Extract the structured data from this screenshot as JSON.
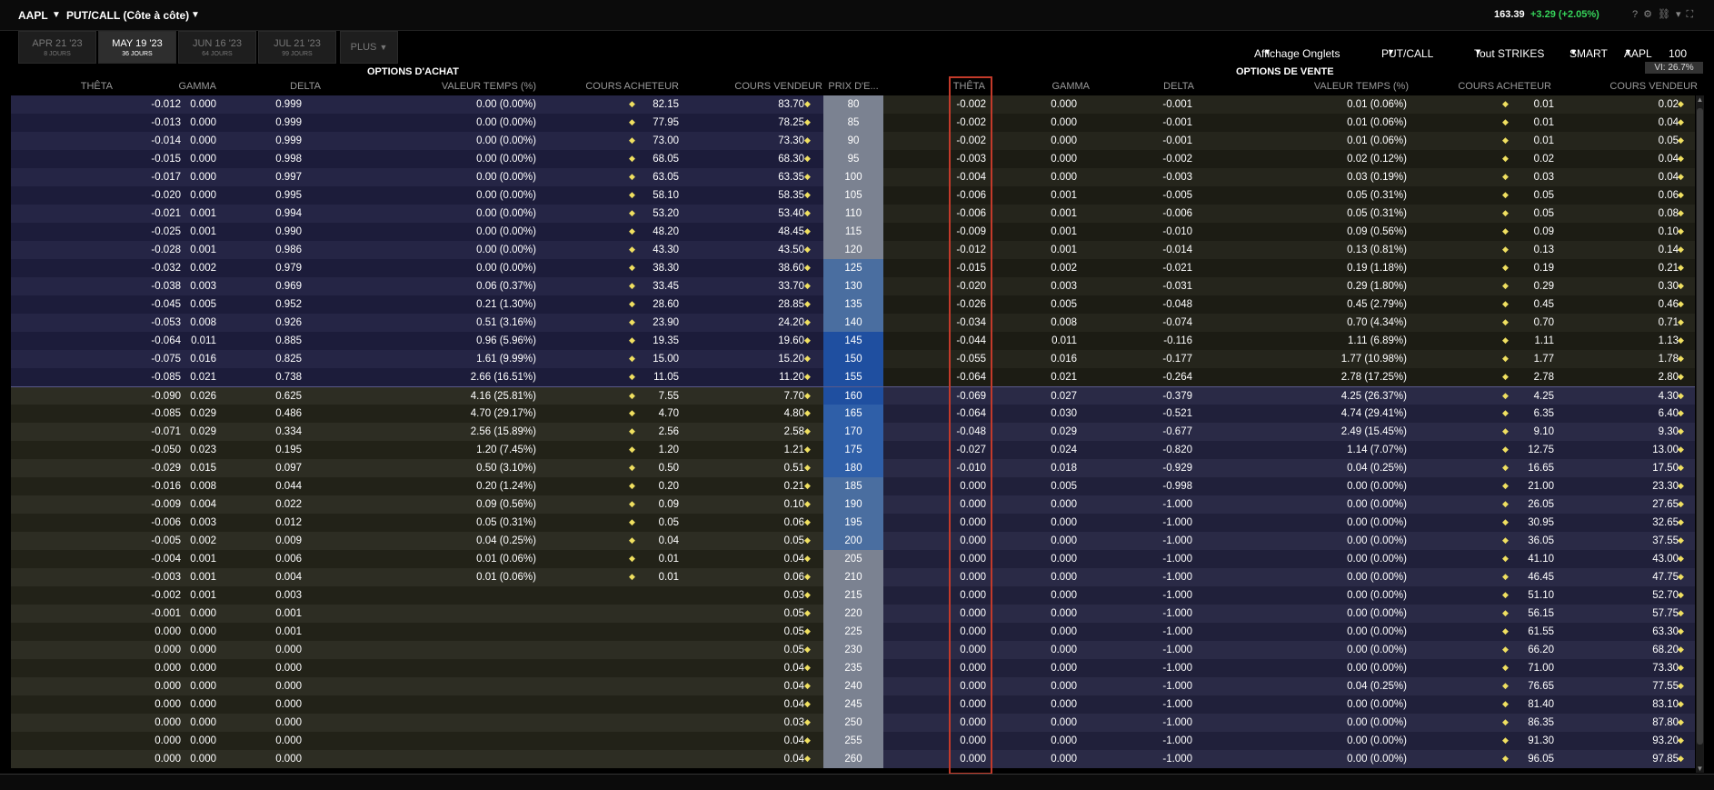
{
  "title": {
    "symbol": "AAPL",
    "mode": "PUT/CALL (Côte à côte)",
    "last": "163.39",
    "change": "+3.29 (+2.05%)"
  },
  "tabs": [
    {
      "date": "APR 21 '23",
      "days": "8 JOURS"
    },
    {
      "date": "MAY 19 '23",
      "days": "36 JOURS"
    },
    {
      "date": "JUN 16 '23",
      "days": "64 JOURS"
    },
    {
      "date": "JUL 21 '23",
      "days": "99 JOURS"
    },
    {
      "date": "PLUS",
      "days": ""
    }
  ],
  "toolbar": {
    "display": "Affichage Onglets",
    "putcall": "PUT/CALL",
    "strikes": "Tout STRIKES",
    "exchange": "SMART",
    "symbol": "AAPL",
    "qty": "100",
    "vi": "VI: 26.7%"
  },
  "sections": {
    "calls": "OPTIONS D'ACHAT",
    "puts": "OPTIONS DE VENTE"
  },
  "headers": {
    "theta": "THÊTA",
    "gamma": "GAMMA",
    "delta": "DELTA",
    "time_value": "VALEUR TEMPS (%)",
    "bid": "COURS ACHETEUR",
    "ask": "COURS VENDEUR",
    "strike": "PRIX D'E..."
  },
  "colors": {
    "row_call_itm_a": "#252545",
    "row_call_itm_b": "#1c1c3a",
    "row_call_otm_a": "#2d2d23",
    "row_call_otm_b": "#222218",
    "row_put_otm_a": "#25251c",
    "row_put_otm_b": "#1c1c14",
    "row_put_itm_a": "#2a2a46",
    "row_put_itm_b": "#20203a",
    "strike_gray": "#7b8291",
    "strike_blue1": "#4a6ea0",
    "strike_blue2": "#2f5fa8",
    "strike_blue3": "#1f4fa0",
    "highlight": "#c33a2a",
    "diamond": "#f0e060",
    "positive": "#36d45a"
  },
  "atm_index": 16,
  "rows": [
    {
      "strike": "80",
      "c": [
        "-0.012",
        "0.000",
        "0.999",
        "0.00 (0.00%)",
        "82.15",
        "83.70"
      ],
      "p": [
        "-0.002",
        "0.000",
        "-0.001",
        "0.01 (0.06%)",
        "0.01",
        "0.02"
      ]
    },
    {
      "strike": "85",
      "c": [
        "-0.013",
        "0.000",
        "0.999",
        "0.00 (0.00%)",
        "77.95",
        "78.25"
      ],
      "p": [
        "-0.002",
        "0.000",
        "-0.001",
        "0.01 (0.06%)",
        "0.01",
        "0.04"
      ]
    },
    {
      "strike": "90",
      "c": [
        "-0.014",
        "0.000",
        "0.999",
        "0.00 (0.00%)",
        "73.00",
        "73.30"
      ],
      "p": [
        "-0.002",
        "0.000",
        "-0.001",
        "0.01 (0.06%)",
        "0.01",
        "0.05"
      ]
    },
    {
      "strike": "95",
      "c": [
        "-0.015",
        "0.000",
        "0.998",
        "0.00 (0.00%)",
        "68.05",
        "68.30"
      ],
      "p": [
        "-0.003",
        "0.000",
        "-0.002",
        "0.02 (0.12%)",
        "0.02",
        "0.04"
      ]
    },
    {
      "strike": "100",
      "c": [
        "-0.017",
        "0.000",
        "0.997",
        "0.00 (0.00%)",
        "63.05",
        "63.35"
      ],
      "p": [
        "-0.004",
        "0.000",
        "-0.003",
        "0.03 (0.19%)",
        "0.03",
        "0.04"
      ]
    },
    {
      "strike": "105",
      "c": [
        "-0.020",
        "0.000",
        "0.995",
        "0.00 (0.00%)",
        "58.10",
        "58.35"
      ],
      "p": [
        "-0.006",
        "0.001",
        "-0.005",
        "0.05 (0.31%)",
        "0.05",
        "0.06"
      ]
    },
    {
      "strike": "110",
      "c": [
        "-0.021",
        "0.001",
        "0.994",
        "0.00 (0.00%)",
        "53.20",
        "53.40"
      ],
      "p": [
        "-0.006",
        "0.001",
        "-0.006",
        "0.05 (0.31%)",
        "0.05",
        "0.08"
      ]
    },
    {
      "strike": "115",
      "c": [
        "-0.025",
        "0.001",
        "0.990",
        "0.00 (0.00%)",
        "48.20",
        "48.45"
      ],
      "p": [
        "-0.009",
        "0.001",
        "-0.010",
        "0.09 (0.56%)",
        "0.09",
        "0.10"
      ]
    },
    {
      "strike": "120",
      "c": [
        "-0.028",
        "0.001",
        "0.986",
        "0.00 (0.00%)",
        "43.30",
        "43.50"
      ],
      "p": [
        "-0.012",
        "0.001",
        "-0.014",
        "0.13 (0.81%)",
        "0.13",
        "0.14"
      ]
    },
    {
      "strike": "125",
      "c": [
        "-0.032",
        "0.002",
        "0.979",
        "0.00 (0.00%)",
        "38.30",
        "38.60"
      ],
      "p": [
        "-0.015",
        "0.002",
        "-0.021",
        "0.19 (1.18%)",
        "0.19",
        "0.21"
      ]
    },
    {
      "strike": "130",
      "c": [
        "-0.038",
        "0.003",
        "0.969",
        "0.06 (0.37%)",
        "33.45",
        "33.70"
      ],
      "p": [
        "-0.020",
        "0.003",
        "-0.031",
        "0.29 (1.80%)",
        "0.29",
        "0.30"
      ]
    },
    {
      "strike": "135",
      "c": [
        "-0.045",
        "0.005",
        "0.952",
        "0.21 (1.30%)",
        "28.60",
        "28.85"
      ],
      "p": [
        "-0.026",
        "0.005",
        "-0.048",
        "0.45 (2.79%)",
        "0.45",
        "0.46"
      ]
    },
    {
      "strike": "140",
      "c": [
        "-0.053",
        "0.008",
        "0.926",
        "0.51 (3.16%)",
        "23.90",
        "24.20"
      ],
      "p": [
        "-0.034",
        "0.008",
        "-0.074",
        "0.70 (4.34%)",
        "0.70",
        "0.71"
      ]
    },
    {
      "strike": "145",
      "c": [
        "-0.064",
        "0.011",
        "0.885",
        "0.96 (5.96%)",
        "19.35",
        "19.60"
      ],
      "p": [
        "-0.044",
        "0.011",
        "-0.116",
        "1.11 (6.89%)",
        "1.11",
        "1.13"
      ]
    },
    {
      "strike": "150",
      "c": [
        "-0.075",
        "0.016",
        "0.825",
        "1.61 (9.99%)",
        "15.00",
        "15.20"
      ],
      "p": [
        "-0.055",
        "0.016",
        "-0.177",
        "1.77 (10.98%)",
        "1.77",
        "1.78"
      ]
    },
    {
      "strike": "155",
      "c": [
        "-0.085",
        "0.021",
        "0.738",
        "2.66 (16.51%)",
        "11.05",
        "11.20"
      ],
      "p": [
        "-0.064",
        "0.021",
        "-0.264",
        "2.78 (17.25%)",
        "2.78",
        "2.80"
      ]
    },
    {
      "strike": "160",
      "c": [
        "-0.090",
        "0.026",
        "0.625",
        "4.16 (25.81%)",
        "7.55",
        "7.70"
      ],
      "p": [
        "-0.069",
        "0.027",
        "-0.379",
        "4.25 (26.37%)",
        "4.25",
        "4.30"
      ]
    },
    {
      "strike": "165",
      "c": [
        "-0.085",
        "0.029",
        "0.486",
        "4.70 (29.17%)",
        "4.70",
        "4.80"
      ],
      "p": [
        "-0.064",
        "0.030",
        "-0.521",
        "4.74 (29.41%)",
        "6.35",
        "6.40"
      ]
    },
    {
      "strike": "170",
      "c": [
        "-0.071",
        "0.029",
        "0.334",
        "2.56 (15.89%)",
        "2.56",
        "2.58"
      ],
      "p": [
        "-0.048",
        "0.029",
        "-0.677",
        "2.49 (15.45%)",
        "9.10",
        "9.30"
      ]
    },
    {
      "strike": "175",
      "c": [
        "-0.050",
        "0.023",
        "0.195",
        "1.20 (7.45%)",
        "1.20",
        "1.21"
      ],
      "p": [
        "-0.027",
        "0.024",
        "-0.820",
        "1.14 (7.07%)",
        "12.75",
        "13.00"
      ]
    },
    {
      "strike": "180",
      "c": [
        "-0.029",
        "0.015",
        "0.097",
        "0.50 (3.10%)",
        "0.50",
        "0.51"
      ],
      "p": [
        "-0.010",
        "0.018",
        "-0.929",
        "0.04 (0.25%)",
        "16.65",
        "17.50"
      ]
    },
    {
      "strike": "185",
      "c": [
        "-0.016",
        "0.008",
        "0.044",
        "0.20 (1.24%)",
        "0.20",
        "0.21"
      ],
      "p": [
        "0.000",
        "0.005",
        "-0.998",
        "0.00 (0.00%)",
        "21.00",
        "23.30"
      ]
    },
    {
      "strike": "190",
      "c": [
        "-0.009",
        "0.004",
        "0.022",
        "0.09 (0.56%)",
        "0.09",
        "0.10"
      ],
      "p": [
        "0.000",
        "0.000",
        "-1.000",
        "0.00 (0.00%)",
        "26.05",
        "27.65"
      ]
    },
    {
      "strike": "195",
      "c": [
        "-0.006",
        "0.003",
        "0.012",
        "0.05 (0.31%)",
        "0.05",
        "0.06"
      ],
      "p": [
        "0.000",
        "0.000",
        "-1.000",
        "0.00 (0.00%)",
        "30.95",
        "32.65"
      ]
    },
    {
      "strike": "200",
      "c": [
        "-0.005",
        "0.002",
        "0.009",
        "0.04 (0.25%)",
        "0.04",
        "0.05"
      ],
      "p": [
        "0.000",
        "0.000",
        "-1.000",
        "0.00 (0.00%)",
        "36.05",
        "37.55"
      ]
    },
    {
      "strike": "205",
      "c": [
        "-0.004",
        "0.001",
        "0.006",
        "0.01 (0.06%)",
        "0.01",
        "0.04"
      ],
      "p": [
        "0.000",
        "0.000",
        "-1.000",
        "0.00 (0.00%)",
        "41.10",
        "43.00"
      ]
    },
    {
      "strike": "210",
      "c": [
        "-0.003",
        "0.001",
        "0.004",
        "0.01 (0.06%)",
        "0.01",
        "0.06"
      ],
      "p": [
        "0.000",
        "0.000",
        "-1.000",
        "0.00 (0.00%)",
        "46.45",
        "47.75"
      ]
    },
    {
      "strike": "215",
      "c": [
        "-0.002",
        "0.001",
        "0.003",
        "",
        "",
        "0.03"
      ],
      "p": [
        "0.000",
        "0.000",
        "-1.000",
        "0.00 (0.00%)",
        "51.10",
        "52.70"
      ]
    },
    {
      "strike": "220",
      "c": [
        "-0.001",
        "0.000",
        "0.001",
        "",
        "",
        "0.05"
      ],
      "p": [
        "0.000",
        "0.000",
        "-1.000",
        "0.00 (0.00%)",
        "56.15",
        "57.75"
      ]
    },
    {
      "strike": "225",
      "c": [
        "0.000",
        "0.000",
        "0.001",
        "",
        "",
        "0.05"
      ],
      "p": [
        "0.000",
        "0.000",
        "-1.000",
        "0.00 (0.00%)",
        "61.55",
        "63.30"
      ]
    },
    {
      "strike": "230",
      "c": [
        "0.000",
        "0.000",
        "0.000",
        "",
        "",
        "0.05"
      ],
      "p": [
        "0.000",
        "0.000",
        "-1.000",
        "0.00 (0.00%)",
        "66.20",
        "68.20"
      ]
    },
    {
      "strike": "235",
      "c": [
        "0.000",
        "0.000",
        "0.000",
        "",
        "",
        "0.04"
      ],
      "p": [
        "0.000",
        "0.000",
        "-1.000",
        "0.00 (0.00%)",
        "71.00",
        "73.30"
      ]
    },
    {
      "strike": "240",
      "c": [
        "0.000",
        "0.000",
        "0.000",
        "",
        "",
        "0.04"
      ],
      "p": [
        "0.000",
        "0.000",
        "-1.000",
        "0.04 (0.25%)",
        "76.65",
        "77.55"
      ]
    },
    {
      "strike": "245",
      "c": [
        "0.000",
        "0.000",
        "0.000",
        "",
        "",
        "0.04"
      ],
      "p": [
        "0.000",
        "0.000",
        "-1.000",
        "0.00 (0.00%)",
        "81.40",
        "83.10"
      ]
    },
    {
      "strike": "250",
      "c": [
        "0.000",
        "0.000",
        "0.000",
        "",
        "",
        "0.03"
      ],
      "p": [
        "0.000",
        "0.000",
        "-1.000",
        "0.00 (0.00%)",
        "86.35",
        "87.80"
      ]
    },
    {
      "strike": "255",
      "c": [
        "0.000",
        "0.000",
        "0.000",
        "",
        "",
        "0.04"
      ],
      "p": [
        "0.000",
        "0.000",
        "-1.000",
        "0.00 (0.00%)",
        "91.30",
        "93.20"
      ]
    },
    {
      "strike": "260",
      "c": [
        "0.000",
        "0.000",
        "0.000",
        "",
        "",
        "0.04"
      ],
      "p": [
        "0.000",
        "0.000",
        "-1.000",
        "0.00 (0.00%)",
        "96.05",
        "97.85"
      ]
    }
  ]
}
